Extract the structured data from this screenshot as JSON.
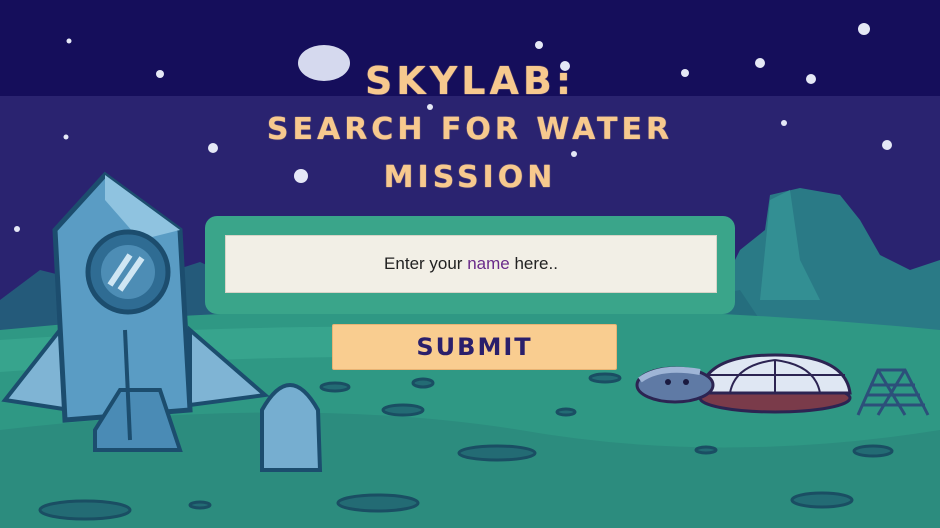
{
  "title": {
    "line1": "SKYLAB:",
    "line2": "SEARCH FOR WATER",
    "line3": "MISSION"
  },
  "form": {
    "name_placeholder_before": "Enter your ",
    "name_placeholder_highlight": "name",
    "name_placeholder_after": " here..",
    "submit_label": "SUBMIT"
  },
  "colors": {
    "sky_top": "#160f5c",
    "sky_bottom": "#2a2370",
    "ground": "#2f9884",
    "title": "#f7c98e",
    "form_box": "#3aa58a",
    "button": "#f9cd90",
    "button_text": "#2a1f6b"
  },
  "icons": [
    "moon-icon",
    "stars-icon",
    "rocket-icon",
    "dome-base-icon",
    "radio-tower-icon",
    "crater-icon"
  ]
}
